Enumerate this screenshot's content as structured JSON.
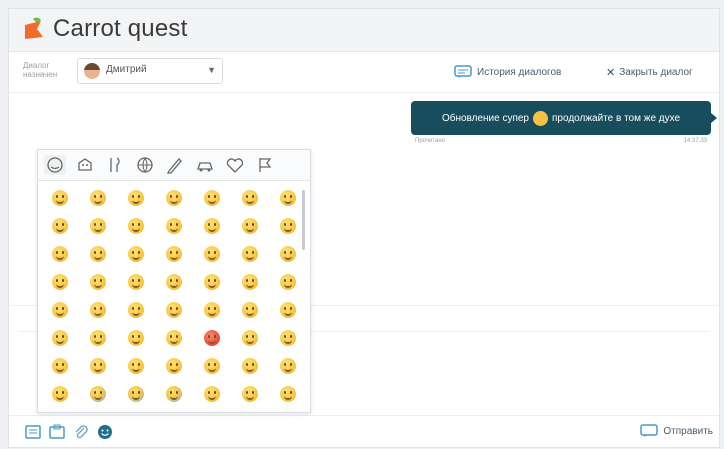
{
  "header": {
    "brand": "Carrot quest"
  },
  "toolbar": {
    "assign_label": "Диалог назначен",
    "agent_name": "Дмитрий",
    "history_label": "История диалогов",
    "close_label": "Закрыть диалог"
  },
  "chat": {
    "message_before": "Обновление супер",
    "message_after": "продолжайте в том же духе",
    "meta_left": "Прочитано",
    "meta_right": "14:37:33"
  },
  "composer": {
    "send_label": "Отправить"
  },
  "colors": {
    "bubble": "#174d5c",
    "brand": "#f26b2a",
    "accent_icon": "#1f6f8b"
  },
  "emoji_picker": {
    "tabs": [
      "smileys-icon",
      "animals-icon",
      "food-icon",
      "sports-icon",
      "objects-icon",
      "travel-icon",
      "heart-icon",
      "flag-icon"
    ],
    "rows": 8,
    "cols": 7
  }
}
